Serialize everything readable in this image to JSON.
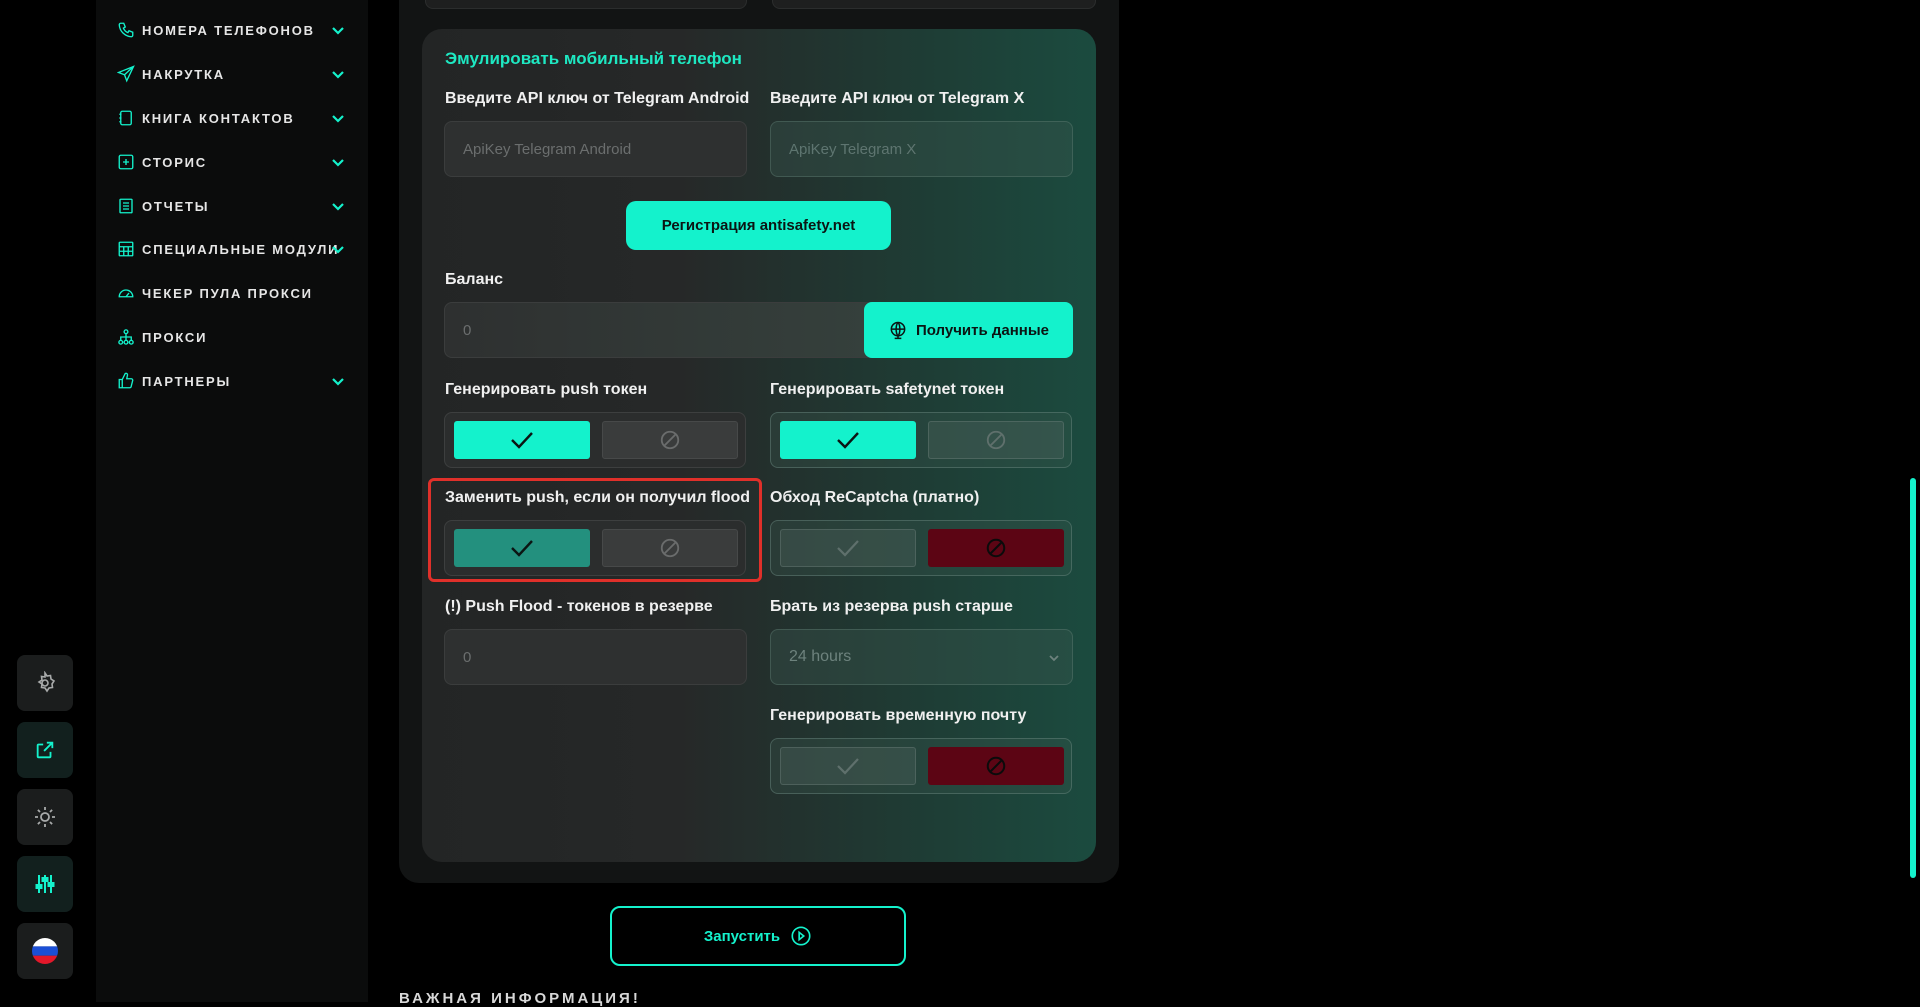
{
  "sidebar": {
    "items": [
      {
        "label": "НОМЕРА ТЕЛЕФОНОВ",
        "icon": "phone-icon",
        "expandable": true
      },
      {
        "label": "НАКРУТКА",
        "icon": "send-icon",
        "expandable": true
      },
      {
        "label": "КНИГА КОНТАКТОВ",
        "icon": "book-icon",
        "expandable": true
      },
      {
        "label": "СТОРИС",
        "icon": "plus-square-icon",
        "expandable": true
      },
      {
        "label": "ОТЧЕТЫ",
        "icon": "report-icon",
        "expandable": true
      },
      {
        "label": "СПЕЦИАЛЬНЫЕ МОДУЛИ",
        "icon": "table-icon",
        "expandable": true
      },
      {
        "label": "ЧЕКЕР ПУЛА ПРОКСИ",
        "icon": "gauge-icon",
        "expandable": false
      },
      {
        "label": "ПРОКСИ",
        "icon": "network-icon",
        "expandable": false
      },
      {
        "label": "ПАРТНЕРЫ",
        "icon": "thumb-up-icon",
        "expandable": true
      }
    ]
  },
  "dock": {
    "items": [
      "gear-icon",
      "external-link-icon",
      "sun-icon",
      "sliders-icon",
      "flag-ru-icon"
    ]
  },
  "card": {
    "title": "Эмулировать мобильный телефон",
    "api_android_label": "Введите API ключ от Telegram Android",
    "api_android_placeholder": "ApiKey Telegram Android",
    "api_x_label": "Введите API ключ от Telegram X",
    "api_x_placeholder": "ApiKey Telegram X",
    "register_button": "Регистрация antisafety.net",
    "balance_label": "Баланс",
    "balance_value": "0",
    "get_data_button": "Получить данные",
    "gen_push_label": "Генерировать push токен",
    "gen_safetynet_label": "Генерировать safetynet токен",
    "replace_push_label": "Заменить push, если он получил flood",
    "recaptcha_label": "Обход ReCaptcha (платно)",
    "push_flood_label": "(!) Push Flood - токенов в резерве",
    "push_flood_value": "0",
    "reserve_label": "Брать из резерва push старше",
    "reserve_value": "24 hours",
    "temp_mail_label": "Генерировать временную почту"
  },
  "toggles": {
    "gen_push": true,
    "gen_safetynet": true,
    "replace_push": true,
    "recaptcha": false,
    "temp_mail": false
  },
  "launch_button": "Запустить",
  "bottom_heading": "ВАЖНАЯ ИНФОРМАЦИЯ!",
  "colors": {
    "accent": "#14f2cc",
    "title": "#1ee8c2",
    "danger": "#5c0514",
    "highlight": "#e0302a"
  }
}
